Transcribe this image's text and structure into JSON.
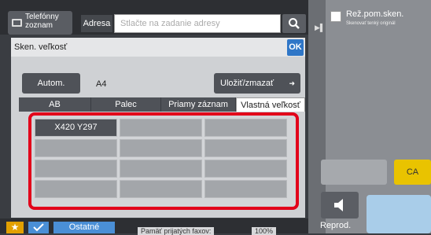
{
  "header": {
    "phonebook_label": "Telefónny zoznam",
    "address_tab": "Adresa",
    "address_placeholder": "Stlačte na zadanie adresy"
  },
  "right_panel": {
    "scan_mode_title": "Rež.pom.sken.",
    "scan_mode_subtitle": "Skenovať tenký originál",
    "ca_label": "CA",
    "reprod_label": "Reprod."
  },
  "dialog": {
    "title": "Sken. veľkosť",
    "ok_label": "OK",
    "auto_label": "Autom.",
    "current_size": "A4",
    "save_label": "Uložiť/zmazať",
    "tabs": [
      {
        "label": "AB"
      },
      {
        "label": "Palec"
      },
      {
        "label": "Priamy záznam"
      },
      {
        "label": "Vlastná veľkosť"
      }
    ],
    "custom_sizes": [
      {
        "label": "X420 Y297"
      },
      {
        "label": ""
      },
      {
        "label": ""
      },
      {
        "label": ""
      },
      {
        "label": ""
      },
      {
        "label": ""
      },
      {
        "label": ""
      },
      {
        "label": ""
      },
      {
        "label": ""
      },
      {
        "label": ""
      },
      {
        "label": ""
      },
      {
        "label": ""
      }
    ]
  },
  "bottom": {
    "other_label": "Ostatné",
    "memory_label": "Pamäť prijatých faxov:",
    "memory_value": "100%"
  },
  "colors": {
    "accent_blue": "#2f76c7",
    "highlight_red": "#e2001a",
    "ca_yellow": "#e9c300",
    "favorite_orange": "#e2a000"
  }
}
